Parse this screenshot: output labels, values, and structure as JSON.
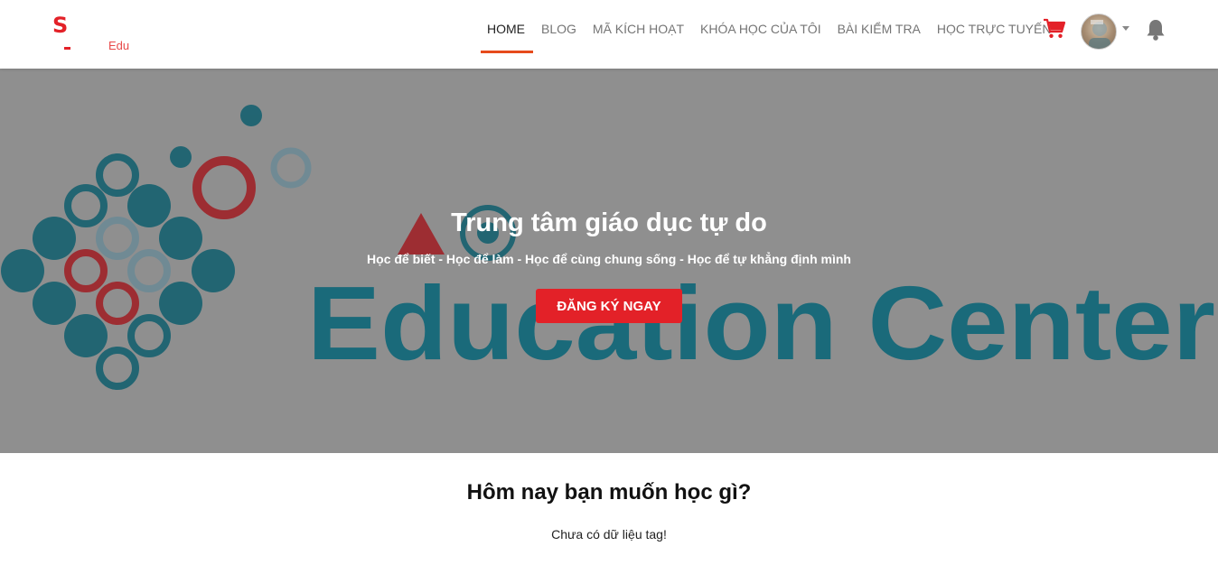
{
  "logo": {
    "letter": "S",
    "suffix": "Edu"
  },
  "nav": {
    "items": [
      {
        "label": "HOME",
        "active": true
      },
      {
        "label": "BLOG"
      },
      {
        "label": "MÃ KÍCH HOẠT"
      },
      {
        "label": "KHÓA HỌC CỦA TÔI"
      },
      {
        "label": "BÀI KIỂM TRA"
      },
      {
        "label": "HỌC TRỰC TUYẾN"
      }
    ]
  },
  "icons": {
    "cart": "shopping-cart-icon",
    "bell": "bell-icon",
    "caret": "chevron-down-icon"
  },
  "hero": {
    "banner_text": "Education Center",
    "title": "Trung tâm giáo dục tự do",
    "subtitle": "Học để biết - Học để làm - Học để cùng chung sống - Học để tự khẳng định mình",
    "cta_label": "ĐĂNG KÝ NGAY"
  },
  "section": {
    "title": "Hôm nay bạn muốn học gì?",
    "empty_message": "Chưa có dữ liệu tag!"
  },
  "colors": {
    "accent": "#e32128",
    "active_underline": "#e64b1c",
    "hero_overlay": "#8f8f8f",
    "banner_teal": "#1a6a7a"
  }
}
